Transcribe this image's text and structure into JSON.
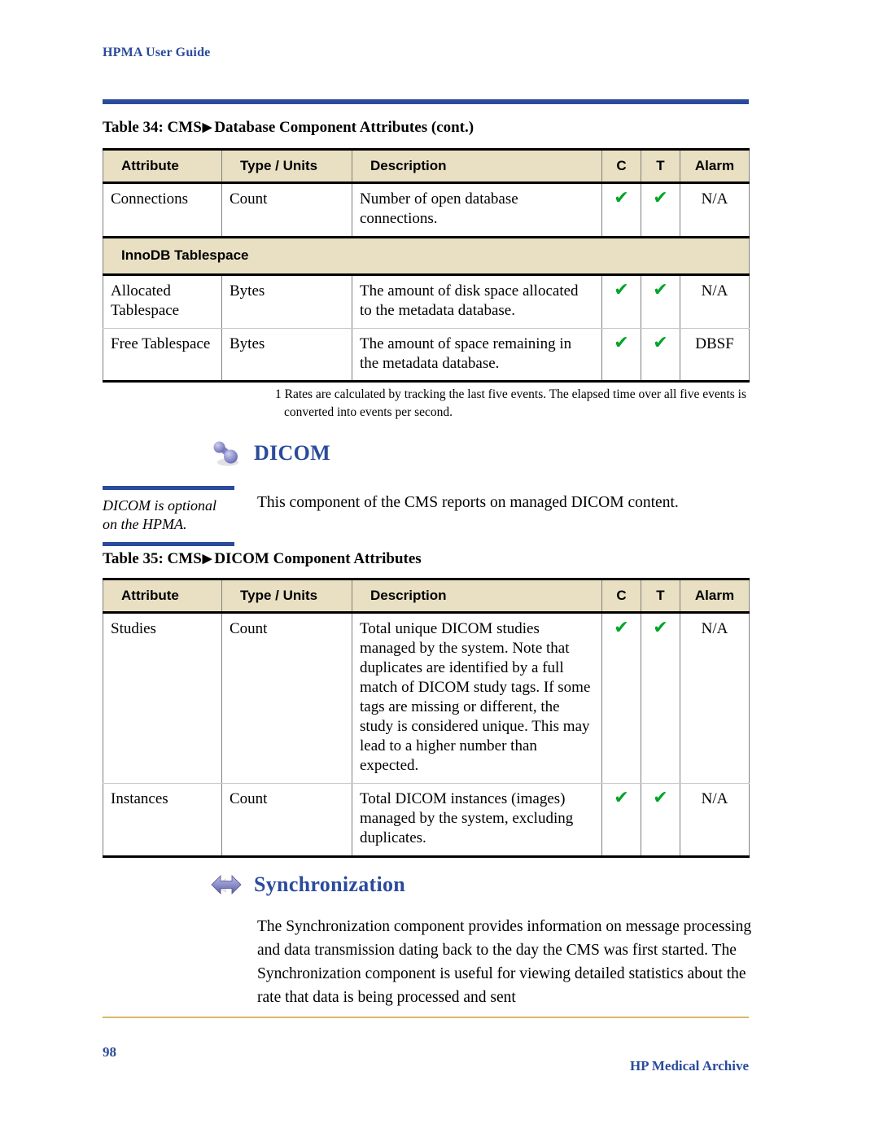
{
  "header": {
    "running_title": "HPMA User Guide",
    "rule_color": "#2a4b9b"
  },
  "tables": [
    {
      "caption_prefix": "Table 34: CMS",
      "caption_sep": "▶",
      "caption_suffix": "Database Component Attributes (cont.)",
      "columns": [
        "Attribute",
        "Type / Units",
        "Description",
        "C",
        "T",
        "Alarm"
      ],
      "rows": [
        {
          "kind": "data",
          "attribute": "Connections",
          "type_units": "Count",
          "description": "Number of open database connections.",
          "c": "✔",
          "t": "✔",
          "alarm": "N/A"
        },
        {
          "kind": "group",
          "label": "InnoDB Tablespace"
        },
        {
          "kind": "data",
          "attribute": "Allocated Tablespace",
          "type_units": "Bytes",
          "description": "The amount of disk space allocated to the metadata database.",
          "c": "✔",
          "t": "✔",
          "alarm": "N/A"
        },
        {
          "kind": "data",
          "attribute": "Free Tablespace",
          "type_units": "Bytes",
          "description": "The amount of space remaining in the metadata database.",
          "c": "✔",
          "t": "✔",
          "alarm": "DBSF"
        }
      ]
    },
    {
      "caption_prefix": "Table 35: CMS",
      "caption_sep": "▶",
      "caption_suffix": "DICOM Component Attributes",
      "columns": [
        "Attribute",
        "Type / Units",
        "Description",
        "C",
        "T",
        "Alarm"
      ],
      "rows": [
        {
          "kind": "data",
          "attribute": "Studies",
          "type_units": "Count",
          "description": "Total unique DICOM studies managed by the system. Note that duplicates are identified by a full match of DICOM study tags. If some tags are missing or different, the study is considered unique. This may lead to a higher number than expected.",
          "c": "✔",
          "t": "✔",
          "alarm": "N/A"
        },
        {
          "kind": "data",
          "attribute": "Instances",
          "type_units": "Count",
          "description": "Total DICOM instances (images) managed by the system, excluding duplicates.",
          "c": "✔",
          "t": "✔",
          "alarm": "N/A"
        }
      ]
    }
  ],
  "footnote": {
    "text": "1 Rates are calculated by tracking the last five events. The elapsed time over all five events is converted into events per second."
  },
  "sections": [
    {
      "id": "dicom",
      "icon": "dicom-molecule-icon",
      "title": "DICOM",
      "margin_note": "DICOM is optional on the HPMA.",
      "body": "This component of the CMS reports on managed DICOM content."
    },
    {
      "id": "synchronization",
      "icon": "sync-double-arrow-icon",
      "title": "Synchronization",
      "body": "The Synchronization component provides information on message processing and data transmission dating back to the day the CMS was first started. The Synchronization component is useful for viewing detailed statistics about the rate that data is being processed and sent"
    }
  ],
  "footer": {
    "page_number": "98",
    "brand": "HP Medical Archive",
    "rule_color": "#d9b96a"
  },
  "colors": {
    "heading_blue": "#2a4b9b",
    "table_header_bg": "#e9e0c3",
    "check_green": "#00a52a",
    "footer_rule": "#d9b96a",
    "icon_purple": "#8b8dc8"
  }
}
